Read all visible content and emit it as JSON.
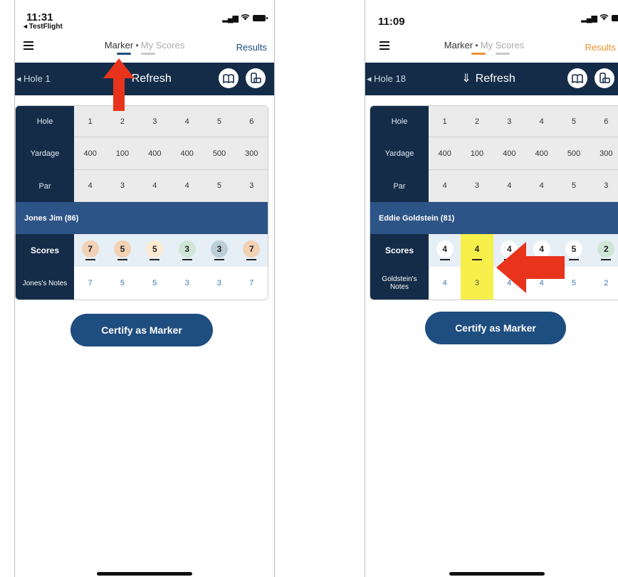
{
  "left": {
    "time": "11:31",
    "back_app": "◂ TestFlight",
    "tab_marker": "Marker",
    "tab_dot": "•",
    "tab_myscores": "My Scores",
    "results": "Results",
    "hole_btn": "◂ Hole 1",
    "refresh": "Refresh",
    "row_labels": {
      "hole": "Hole",
      "yardage": "Yardage",
      "par": "Par",
      "scores": "Scores",
      "notes": "Jones's Notes"
    },
    "holes": [
      "1",
      "2",
      "3",
      "4",
      "5",
      "6"
    ],
    "yardage": [
      "400",
      "100",
      "400",
      "400",
      "500",
      "300"
    ],
    "par": [
      "4",
      "3",
      "4",
      "4",
      "5",
      "3"
    ],
    "player": "Jones Jim (86)",
    "scores": [
      "7",
      "5",
      "5",
      "3",
      "3",
      "7"
    ],
    "score_colors": [
      "#f2d2b4",
      "#f2d2b4",
      "#fdebd2",
      "#cfe6d6",
      "#bccfd8",
      "#f2d2b4"
    ],
    "notes": [
      "7",
      "5",
      "5",
      "3",
      "3",
      "7"
    ],
    "certify": "Certify as Marker",
    "accent": "#1e4d80"
  },
  "right": {
    "time": "11:09",
    "tab_marker": "Marker",
    "tab_dot": "•",
    "tab_myscores": "My Scores",
    "results": "Results",
    "hole_btn": "◂ Hole 18",
    "refresh": "Refresh",
    "row_labels": {
      "hole": "Hole",
      "yardage": "Yardage",
      "par": "Par",
      "scores": "Scores",
      "notes": "Goldstein's Notes"
    },
    "holes": [
      "1",
      "2",
      "3",
      "4",
      "5",
      "6"
    ],
    "yardage": [
      "400",
      "100",
      "400",
      "400",
      "500",
      "300"
    ],
    "par": [
      "4",
      "3",
      "4",
      "4",
      "5",
      "3"
    ],
    "player": "Eddie Goldstein (81)",
    "scores": [
      "4",
      "4",
      "4",
      "4",
      "5",
      "2"
    ],
    "notes": [
      "4",
      "3",
      "4",
      "4",
      "5",
      "2"
    ],
    "highlight_hole": "2",
    "certify": "Certify as Marker",
    "accent": "#f0922b"
  }
}
